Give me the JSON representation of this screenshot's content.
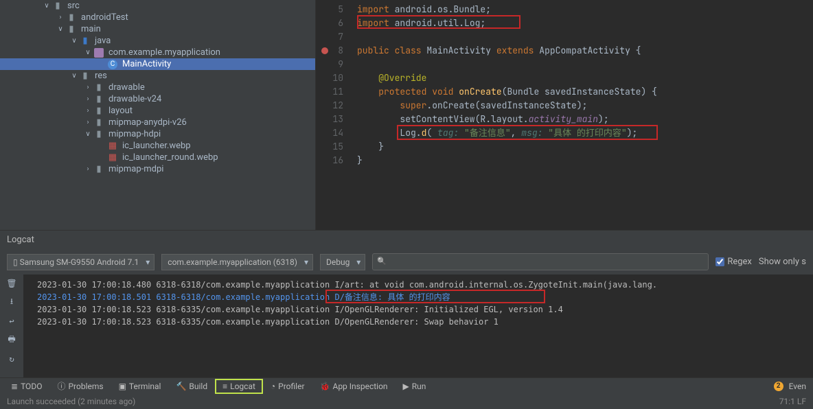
{
  "tree": {
    "items": [
      {
        "indent": 60,
        "chev": "∨",
        "icon": "folder",
        "label": "src"
      },
      {
        "indent": 80,
        "chev": "›",
        "icon": "folder",
        "label": "androidTest"
      },
      {
        "indent": 80,
        "chev": "∨",
        "icon": "folder",
        "label": "main"
      },
      {
        "indent": 100,
        "chev": "∨",
        "icon": "folder-blue",
        "label": "java"
      },
      {
        "indent": 120,
        "chev": "∨",
        "icon": "pkg",
        "label": "com.example.myapplication"
      },
      {
        "indent": 140,
        "chev": "",
        "icon": "class",
        "label": "MainActivity",
        "selected": true
      },
      {
        "indent": 100,
        "chev": "∨",
        "icon": "folder",
        "label": "res"
      },
      {
        "indent": 120,
        "chev": "›",
        "icon": "folder",
        "label": "drawable"
      },
      {
        "indent": 120,
        "chev": "›",
        "icon": "folder",
        "label": "drawable-v24"
      },
      {
        "indent": 120,
        "chev": "›",
        "icon": "folder",
        "label": "layout"
      },
      {
        "indent": 120,
        "chev": "›",
        "icon": "folder",
        "label": "mipmap-anydpi-v26"
      },
      {
        "indent": 120,
        "chev": "∨",
        "icon": "folder",
        "label": "mipmap-hdpi"
      },
      {
        "indent": 140,
        "chev": "",
        "icon": "img",
        "label": "ic_launcher.webp"
      },
      {
        "indent": 140,
        "chev": "",
        "icon": "img",
        "label": "ic_launcher_round.webp"
      },
      {
        "indent": 120,
        "chev": "›",
        "icon": "folder",
        "label": "mipmap-mdpi"
      }
    ]
  },
  "editor": {
    "lines": [
      {
        "n": 5,
        "html": "<span class='kw'>import</span> <span class='typ'>android.os.Bundle</span>;"
      },
      {
        "n": 6,
        "html": "<span class='kw'>import</span> <span class='typ'>android.util.Log</span>;"
      },
      {
        "n": 7,
        "html": ""
      },
      {
        "n": 8,
        "bp": true,
        "html": "<span class='kw'>public class</span> <span class='cls'>MainActivity</span> <span class='kw'>extends</span> <span class='cls'>AppCompatActivity</span> {"
      },
      {
        "n": 9,
        "html": ""
      },
      {
        "n": 10,
        "html": "    <span class='ann'>@Override</span>"
      },
      {
        "n": 11,
        "html": "    <span class='kw'>protected void</span> <span class='fn'>onCreate</span>(<span class='typ'>Bundle</span> savedInstanceState) {"
      },
      {
        "n": 12,
        "html": "        <span class='kw'>super</span>.onCreate(savedInstanceState);"
      },
      {
        "n": 13,
        "html": "        setContentView(R.layout.<span class='italic'>activity_main</span>);"
      },
      {
        "n": 14,
        "html": "        Log.<span class='fn'>d</span>( <span class='param'>tag:</span> <span class='str'>\"备注信息\"</span>, <span class='param'>msg:</span> <span class='str'>\"具体 的打印内容\"</span>);"
      },
      {
        "n": 15,
        "html": "    }"
      },
      {
        "n": 16,
        "html": "}"
      }
    ]
  },
  "logcat": {
    "title": "Logcat",
    "device": "Samsung SM-G9550 Android 7.1",
    "process": "com.example.myapplication (6318)",
    "level": "Debug",
    "search": "",
    "regex": "Regex",
    "showonly": "Show only s",
    "lines": [
      "2023-01-30 17:00:18.480 6318-6318/com.example.myapplication I/art:     at void com.android.internal.os.ZygoteInit.main(java.lang.",
      "2023-01-30 17:00:18.501 6318-6318/com.example.myapplication D/备注信息: 具体 的打印内容",
      "2023-01-30 17:00:18.523 6318-6335/com.example.myapplication I/OpenGLRenderer: Initialized EGL, version 1.4",
      "2023-01-30 17:00:18.523 6318-6335/com.example.myapplication D/OpenGLRenderer: Swap behavior 1"
    ]
  },
  "tabs": {
    "todo": "TODO",
    "problems": "Problems",
    "terminal": "Terminal",
    "build": "Build",
    "logcat": "Logcat",
    "profiler": "Profiler",
    "appinspection": "App Inspection",
    "run": "Run",
    "event": "Even"
  },
  "status": {
    "left": "Launch succeeded (2 minutes ago)",
    "right": "71:1   LF"
  }
}
